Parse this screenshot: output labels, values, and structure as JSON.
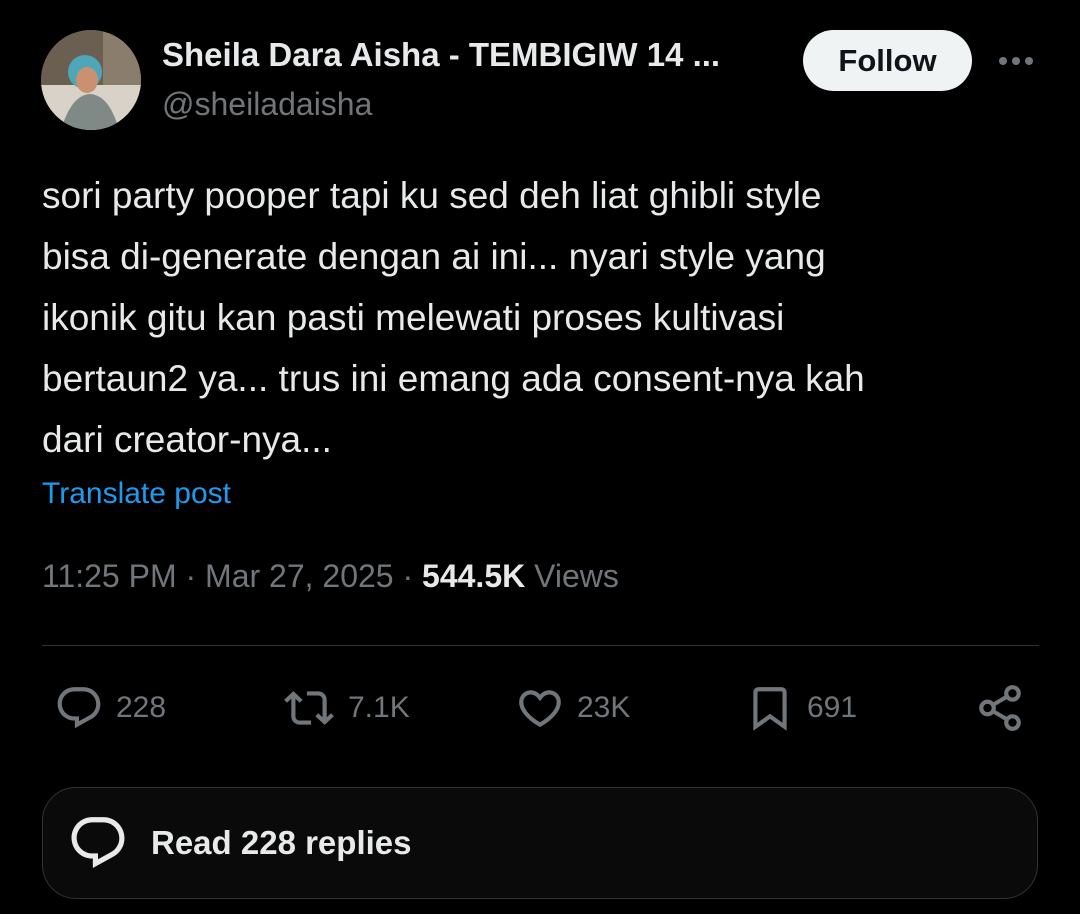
{
  "author": {
    "display_name": "Sheila Dara Aisha - TEMBIGIW 14 ...",
    "handle": "@sheiladaisha",
    "avatar_icon": "profile-photo"
  },
  "header": {
    "follow_label": "Follow",
    "more_icon": "ellipsis-icon"
  },
  "tweet": {
    "lines": [
      "sori party pooper tapi ku sed deh liat ghibli style",
      "bisa di-generate dengan ai ini... nyari style yang",
      "ikonik gitu kan pasti melewati proses kultivasi",
      "bertaun2 ya... trus ini emang ada consent-nya kah",
      "dari creator-nya..."
    ],
    "translate_label": "Translate post"
  },
  "meta": {
    "time": "11:25 PM",
    "separator": " · ",
    "date": "Mar 27, 2025",
    "views_count": "544.5K",
    "views_label": " Views"
  },
  "actions": {
    "replies": "228",
    "reposts": "7.1K",
    "likes": "23K",
    "bookmarks": "691"
  },
  "read_replies": {
    "label": "Read 228 replies"
  },
  "colors": {
    "background": "#000000",
    "text": "#e7e9ea",
    "secondary": "#71767b",
    "link": "#1d9bf0",
    "button_bg": "#eff3f4"
  }
}
